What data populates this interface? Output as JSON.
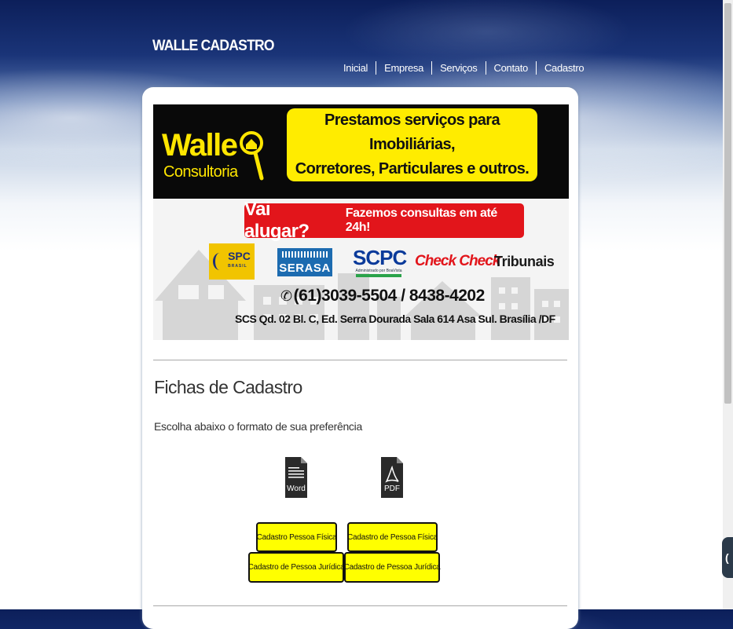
{
  "site": {
    "title": "WALLE CADASTRO"
  },
  "nav": {
    "items": [
      "Inicial",
      "Empresa",
      "Serviços",
      "Contato",
      "Cadastro"
    ]
  },
  "banner": {
    "logo_name": "Walle",
    "logo_sub": "Consultoria",
    "headline_line1": "Prestamos serviços para Imobiliárias,",
    "headline_line2": "Corretores, Particulares e outros.",
    "promo_big": "Vai alugar?",
    "promo_small": "Fazemos consultas em até 24h!",
    "partners": {
      "spc": "SPC",
      "spc_sub": "BRASIL",
      "serasa": "SERASA",
      "scpc": "SCPC",
      "scpc_sub": "Administrado por BoaVista",
      "check": "Check Check",
      "tribunais": "Tribunais"
    },
    "phone": "(61)3039-5504  /  8438-4202",
    "address": "SCS Qd. 02 Bl. C, Ed. Serra Dourada Sala 614  Asa Sul. Brasília /DF"
  },
  "content": {
    "heading": "Fichas de Cadastro",
    "intro": "Escolha abaixo o formato de sua preferência",
    "formats": [
      {
        "label": "Word",
        "icon": "word-document-icon"
      },
      {
        "label": "PDF",
        "icon": "pdf-document-icon"
      }
    ],
    "buttons": {
      "word_fisica": "Cadastro Pessoa Física",
      "pdf_fisica": "Cadastro de Pessoa Física",
      "word_juridica": "Cadastro de Pessoa Jurídica",
      "pdf_juridica": "Cadastro de Pessoa Jurídica"
    }
  },
  "colors": {
    "accent_yellow": "#ffff00",
    "banner_red": "#e2151b",
    "sky_dark": "#0c1f5a"
  }
}
